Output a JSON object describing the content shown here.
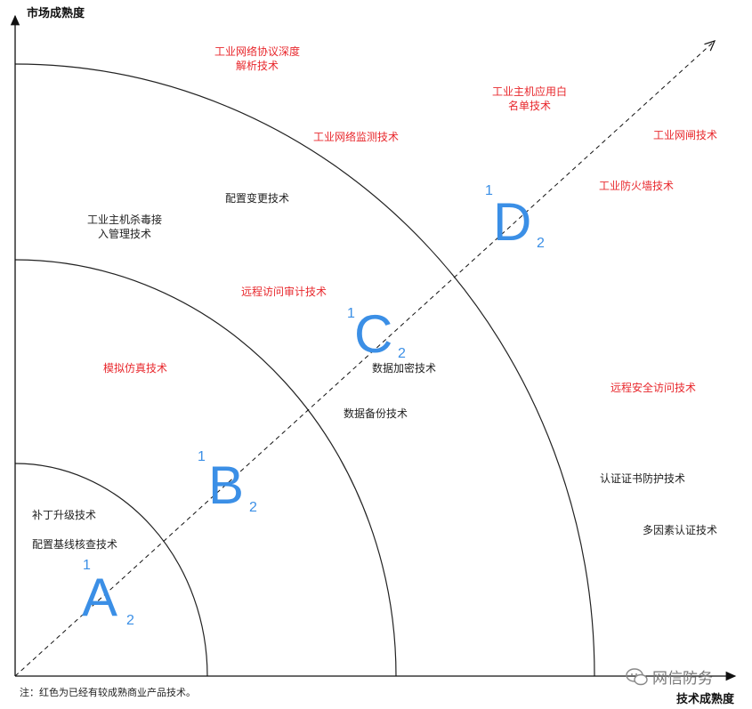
{
  "axes": {
    "y_title": "市场成熟度",
    "x_title": "技术成熟度"
  },
  "zones": [
    {
      "letter": "A",
      "sup": "1",
      "sub": "2"
    },
    {
      "letter": "B",
      "sup": "1",
      "sub": "2"
    },
    {
      "letter": "C",
      "sup": "1",
      "sub": "2"
    },
    {
      "letter": "D",
      "sup": "1",
      "sub": "2"
    }
  ],
  "technologies": [
    {
      "text": "工业网络协议深度\n解析技术",
      "mature": true
    },
    {
      "text": "工业主机应用白\n名单技术",
      "mature": true
    },
    {
      "text": "工业网络监测技术",
      "mature": true
    },
    {
      "text": "工业网闸技术",
      "mature": true
    },
    {
      "text": "工业防火墙技术",
      "mature": true
    },
    {
      "text": "配置变更技术",
      "mature": false
    },
    {
      "text": "工业主机杀毒接\n入管理技术",
      "mature": false
    },
    {
      "text": "远程访问审计技术",
      "mature": true
    },
    {
      "text": "模拟仿真技术",
      "mature": true
    },
    {
      "text": "数据加密技术",
      "mature": false
    },
    {
      "text": "数据备份技术",
      "mature": false
    },
    {
      "text": "远程安全访问技术",
      "mature": true
    },
    {
      "text": "认证证书防护技术",
      "mature": false
    },
    {
      "text": "多因素认证技术",
      "mature": false
    },
    {
      "text": "补丁升级技术",
      "mature": false
    },
    {
      "text": "配置基线核查技术",
      "mature": false
    }
  ],
  "note": "注：红色为已经有较成熟商业产品技术。",
  "watermark": "网信防务",
  "colors": {
    "mature": "#e8282d",
    "normal": "#222222",
    "zone": "#3b8fe6"
  }
}
